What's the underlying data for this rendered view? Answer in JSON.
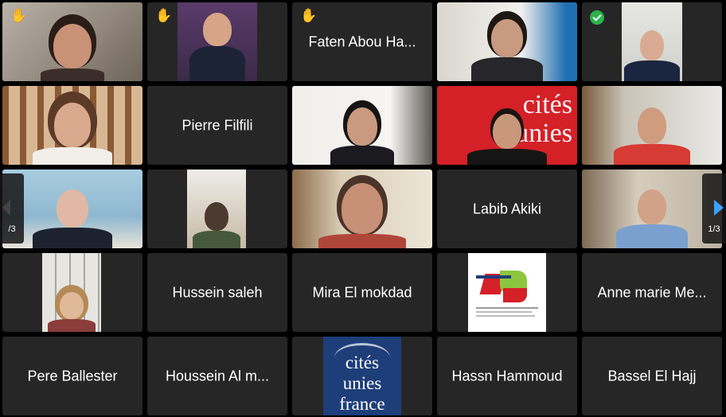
{
  "participants": {
    "faten": "Faten Abou Ha...",
    "pierre": "Pierre Filfili",
    "labib": "Labib Akiki",
    "hussein": "Hussein saleh",
    "mira": "Mira El mokdad",
    "anne": "Anne marie Me...",
    "pere": "Pere Ballester",
    "houssein": "Houssein Al m...",
    "hassn": "Hassn Hammoud",
    "bassel": "Bassel El Hajj"
  },
  "logo": {
    "cites_unies_word1": "cités",
    "cites_unies_word2": "unies",
    "cites_unies_word3": "france"
  },
  "pagination": {
    "left_page": "/3",
    "right_page": "1/3"
  },
  "icons": {
    "raised_hand": "✋",
    "raise_hand_icon_name": "raised-hand-icon",
    "check_icon_name": "check-icon"
  },
  "colors": {
    "tile_bg": "#262626",
    "active_border": "#5fd44f",
    "nav_arrow": "#3aa0ff",
    "cites_red": "#d42027",
    "cites_navy": "#1d3e79"
  }
}
